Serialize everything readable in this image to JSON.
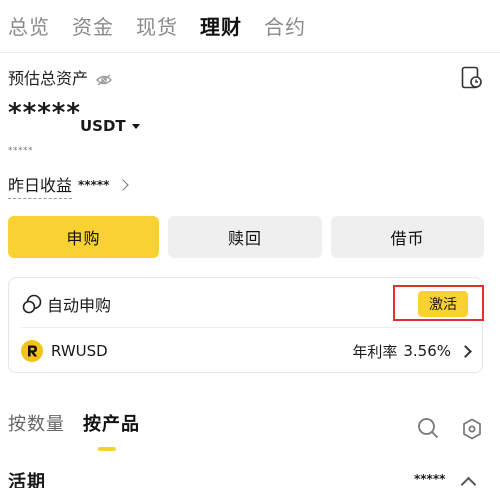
{
  "top_tabs": [
    "总览",
    "资金",
    "现货",
    "理财",
    "合约"
  ],
  "active_top_tab": "理财",
  "assets": {
    "label": "预估总资产",
    "value": "*****",
    "currency": "USDT",
    "sub_value": "*****"
  },
  "yesterday": {
    "label": "昨日收益",
    "value": "*****"
  },
  "actions": {
    "subscribe": "申购",
    "redeem": "赎回",
    "borrow": "借币"
  },
  "auto_subscribe": {
    "label": "自动申购",
    "activate_label": "激活"
  },
  "product": {
    "name": "RWUSD",
    "rate_label": "年利率",
    "rate_value": "3.56%"
  },
  "sub_tabs": [
    "按数量",
    "按产品"
  ],
  "active_sub_tab": "按产品",
  "section": {
    "title": "活期",
    "value": "*****"
  },
  "colors": {
    "accent": "#f9d133",
    "highlight": "#e03131"
  },
  "icons": [
    "eye-off-icon",
    "record-icon",
    "caret-down-icon",
    "chevron-right-icon",
    "auto-subscribe-icon",
    "rwusd-coin-icon",
    "search-icon",
    "filter-icon",
    "chevron-up-icon"
  ]
}
